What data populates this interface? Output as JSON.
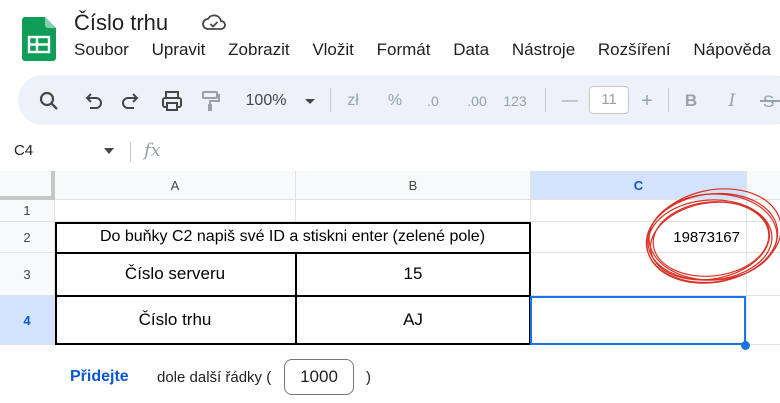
{
  "header": {
    "title": "Číslo trhu",
    "menu": [
      "Soubor",
      "Upravit",
      "Zobrazit",
      "Vložit",
      "Formát",
      "Data",
      "Nástroje",
      "Rozšíření",
      "Nápověda"
    ]
  },
  "toolbar": {
    "zoom": "100%",
    "currency": "zł",
    "percent": "%",
    "dec_decrease": ".0",
    "dec_increase": ".00",
    "number_format": "123",
    "minus": "—",
    "font_size": "11",
    "plus": "+",
    "bold": "B",
    "italic": "I"
  },
  "formula_bar": {
    "name_box": "C4",
    "fx": "fx"
  },
  "grid": {
    "columns": [
      "A",
      "B",
      "C"
    ],
    "rows": [
      "1",
      "2",
      "3",
      "4"
    ],
    "cells": {
      "A2": "Do buňky C2 napiš své ID a stiskni enter (zelené pole)",
      "C2": "19873167",
      "A3": "Číslo serveru",
      "B3": "15",
      "A4": "Číslo trhu",
      "B4": "AJ"
    }
  },
  "footer": {
    "add_label": "Přidejte",
    "text": "dole další řádky (",
    "rows_value": "1000",
    "close": ")"
  },
  "colors": {
    "accent": "#1a73e8",
    "annotation": "#d93025",
    "toolbar_bg": "#edf2fa"
  }
}
